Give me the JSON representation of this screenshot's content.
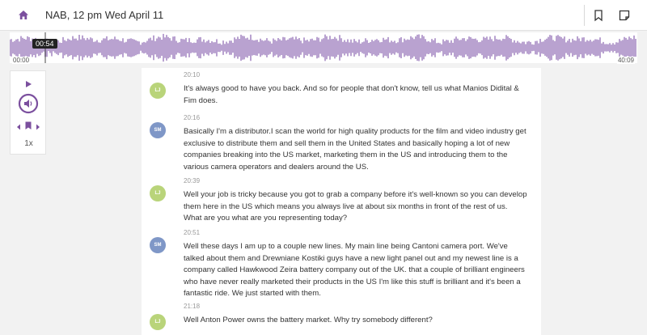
{
  "header": {
    "title": "NAB, 12 pm Wed April 11",
    "icons": [
      "home-icon",
      "bookmark-icon",
      "note-icon"
    ]
  },
  "player": {
    "time_start": "00:00",
    "time_end": "40:09",
    "time_current": "00:54",
    "speed": "1x",
    "wave_color": "#b9a2d0",
    "accent": "#7b4f9e"
  },
  "transcript": [
    {
      "speaker": "LJ",
      "time": "20:10",
      "text": "It's always good to have you back. And so for people that don't know, tell us what Manios Didital & Fim does."
    },
    {
      "speaker": "SM",
      "time": "20:16",
      "text": "Basically I'm a distributor.I scan the world for high quality products for the film and video industry get exclusive to distribute them and sell them in the United States and basically hoping a lot of new companies breaking into the US market, marketing them in the US and introducing them to the various camera operators and dealers around the US."
    },
    {
      "speaker": "LJ",
      "time": "20:39",
      "text": "Well your job is tricky because you got to grab a company before it's well-known so you can develop them here in the US which means you always live at about six months in front of the rest of us. What are you what are you representing today?"
    },
    {
      "speaker": "SM",
      "time": "20:51",
      "text": "Well these days I am up to a couple new lines. My main line being Cantoni camera port. We've talked about them and Drewniane Kostiki guys have a new light panel out and my newest line is a company called Hawkwood Zeira battery company out of the UK. that a couple of brilliant engineers who have never really marketed their products in the US I'm like this stuff is brilliant and it's been a fantastic ride. We just started with them."
    },
    {
      "speaker": "LJ",
      "time": "21:18",
      "text": "Well Anton Power owns the battery market. Why try somebody different?"
    }
  ]
}
